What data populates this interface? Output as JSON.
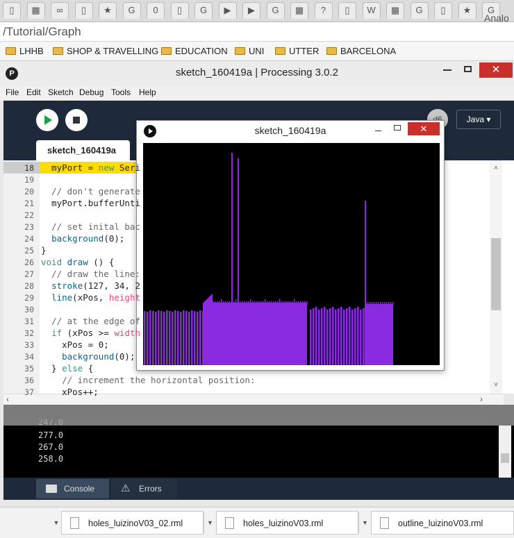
{
  "browser": {
    "tab_glyphs": [
      "▯",
      "▦",
      "∞",
      "▯",
      "★",
      "G",
      "0",
      "▯",
      "G",
      "▶",
      "▶",
      "G",
      "▦",
      "?",
      "▯",
      "W",
      "▦",
      "G",
      "▯",
      "★",
      "G"
    ],
    "url": "/Tutorial/Graph",
    "bookmarks": [
      "LHHB",
      "SHOP & TRAVELLING",
      "EDUCATION",
      "UNI",
      "UTTER",
      "BARCELONA"
    ],
    "overlay_label": "Analo"
  },
  "ide": {
    "title": "sketch_160419a | Processing 3.0.2",
    "menus": [
      "File",
      "Edit",
      "Sketch",
      "Debug",
      "Tools",
      "Help"
    ],
    "mode": "Java ▾",
    "tab_label": "sketch_160419a",
    "code_lines": [
      {
        "num": "18",
        "text": "  myPort = new Seri"
      },
      {
        "num": "19",
        "text": ""
      },
      {
        "num": "20",
        "text": "  // don't generate"
      },
      {
        "num": "21",
        "text": "  myPort.bufferUnti"
      },
      {
        "num": "22",
        "text": ""
      },
      {
        "num": "23",
        "text": "  // set inital bac"
      },
      {
        "num": "24",
        "text": "  background(0);"
      },
      {
        "num": "25",
        "text": "}"
      },
      {
        "num": "26",
        "text": "void draw () {"
      },
      {
        "num": "27",
        "text": "  // draw the line:"
      },
      {
        "num": "28",
        "text": "  stroke(127, 34, 2"
      },
      {
        "num": "29",
        "text": "  line(xPos, height"
      },
      {
        "num": "30",
        "text": ""
      },
      {
        "num": "31",
        "text": "  // at the edge of"
      },
      {
        "num": "32",
        "text": "  if (xPos >= width"
      },
      {
        "num": "33",
        "text": "    xPos = 0;"
      },
      {
        "num": "34",
        "text": "    background(0);"
      },
      {
        "num": "35",
        "text": "  } else {"
      },
      {
        "num": "36",
        "text": "    // increment the horizontal position:"
      },
      {
        "num": "37",
        "text": "    xPos++;"
      }
    ],
    "console_lines": [
      "277.0",
      "267.0",
      "258.0"
    ],
    "console_tab": "Console",
    "errors_tab": "Errors"
  },
  "sketch_window": {
    "title": "sketch_160419a",
    "plot_color": "#8a2be2"
  },
  "downloads": [
    "holes_luizinoV03_02.rml",
    "holes_luizinoV03.rml",
    "outline_luizinoV03.rml"
  ]
}
